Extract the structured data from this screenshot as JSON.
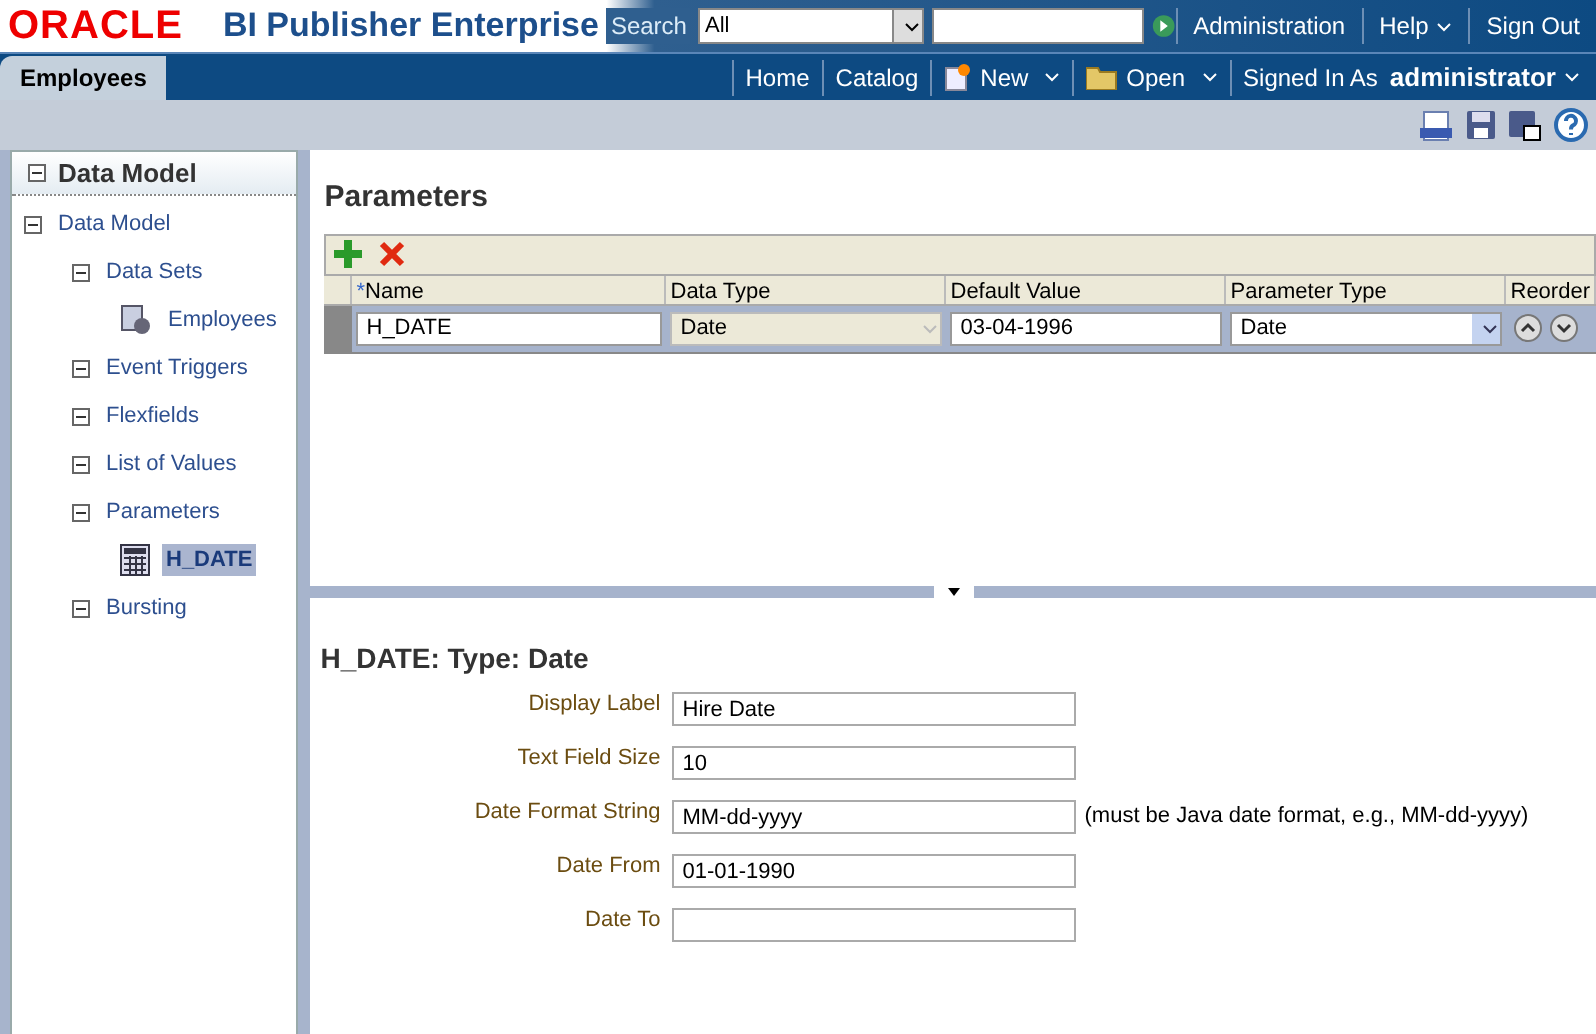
{
  "header": {
    "logo": "ORACLE",
    "product": "BI Publisher Enterprise",
    "search_label": "Search",
    "search_scope": "All",
    "links": [
      "Administration",
      "Help",
      "Sign Out"
    ]
  },
  "nav": {
    "tab": "Employees",
    "links": [
      {
        "label": "Home",
        "menu": false
      },
      {
        "label": "Catalog",
        "menu": false
      },
      {
        "label": "New",
        "menu": true
      },
      {
        "label": "Open",
        "menu": true
      }
    ],
    "signed_in_label": "Signed In As",
    "user": "administrator"
  },
  "sidebar": {
    "title": "Data Model",
    "tree": [
      {
        "label": "Data Model",
        "kind": "folder",
        "expanded": true,
        "selected": false,
        "children": [
          {
            "label": "Data Sets",
            "kind": "folder",
            "expanded": true,
            "selected": false,
            "children": [
              {
                "label": "Employees",
                "kind": "dataset",
                "selected": false
              }
            ]
          },
          {
            "label": "Event Triggers",
            "kind": "folder",
            "expanded": true,
            "selected": false
          },
          {
            "label": "Flexfields",
            "kind": "folder",
            "expanded": true,
            "selected": false
          },
          {
            "label": "List of Values",
            "kind": "folder",
            "expanded": true,
            "selected": false
          },
          {
            "label": "Parameters",
            "kind": "folder",
            "expanded": true,
            "selected": false,
            "children": [
              {
                "label": "H_DATE",
                "kind": "parameter",
                "selected": true
              }
            ]
          },
          {
            "label": "Bursting",
            "kind": "folder",
            "expanded": true,
            "selected": false
          }
        ]
      }
    ]
  },
  "parameters": {
    "title": "Parameters",
    "required_mark": "*",
    "columns": [
      "Name",
      "Data Type",
      "Default Value",
      "Parameter Type",
      "Reorder"
    ],
    "rows": [
      {
        "name": "H_DATE",
        "data_type": "Date",
        "data_type_disabled": true,
        "default_value": "03-04-1996",
        "parameter_type": "Date"
      }
    ]
  },
  "detail": {
    "title": "H_DATE: Type: Date",
    "fields": [
      {
        "label": "Display Label",
        "value": "Hire Date"
      },
      {
        "label": "Text Field Size",
        "value": "10"
      },
      {
        "label": "Date Format String",
        "value": "MM-dd-yyyy",
        "hint": "(must be Java date format, e.g., MM-dd-yyyy)"
      },
      {
        "label": "Date From",
        "value": "01-01-1990"
      },
      {
        "label": "Date To"
      }
    ]
  }
}
